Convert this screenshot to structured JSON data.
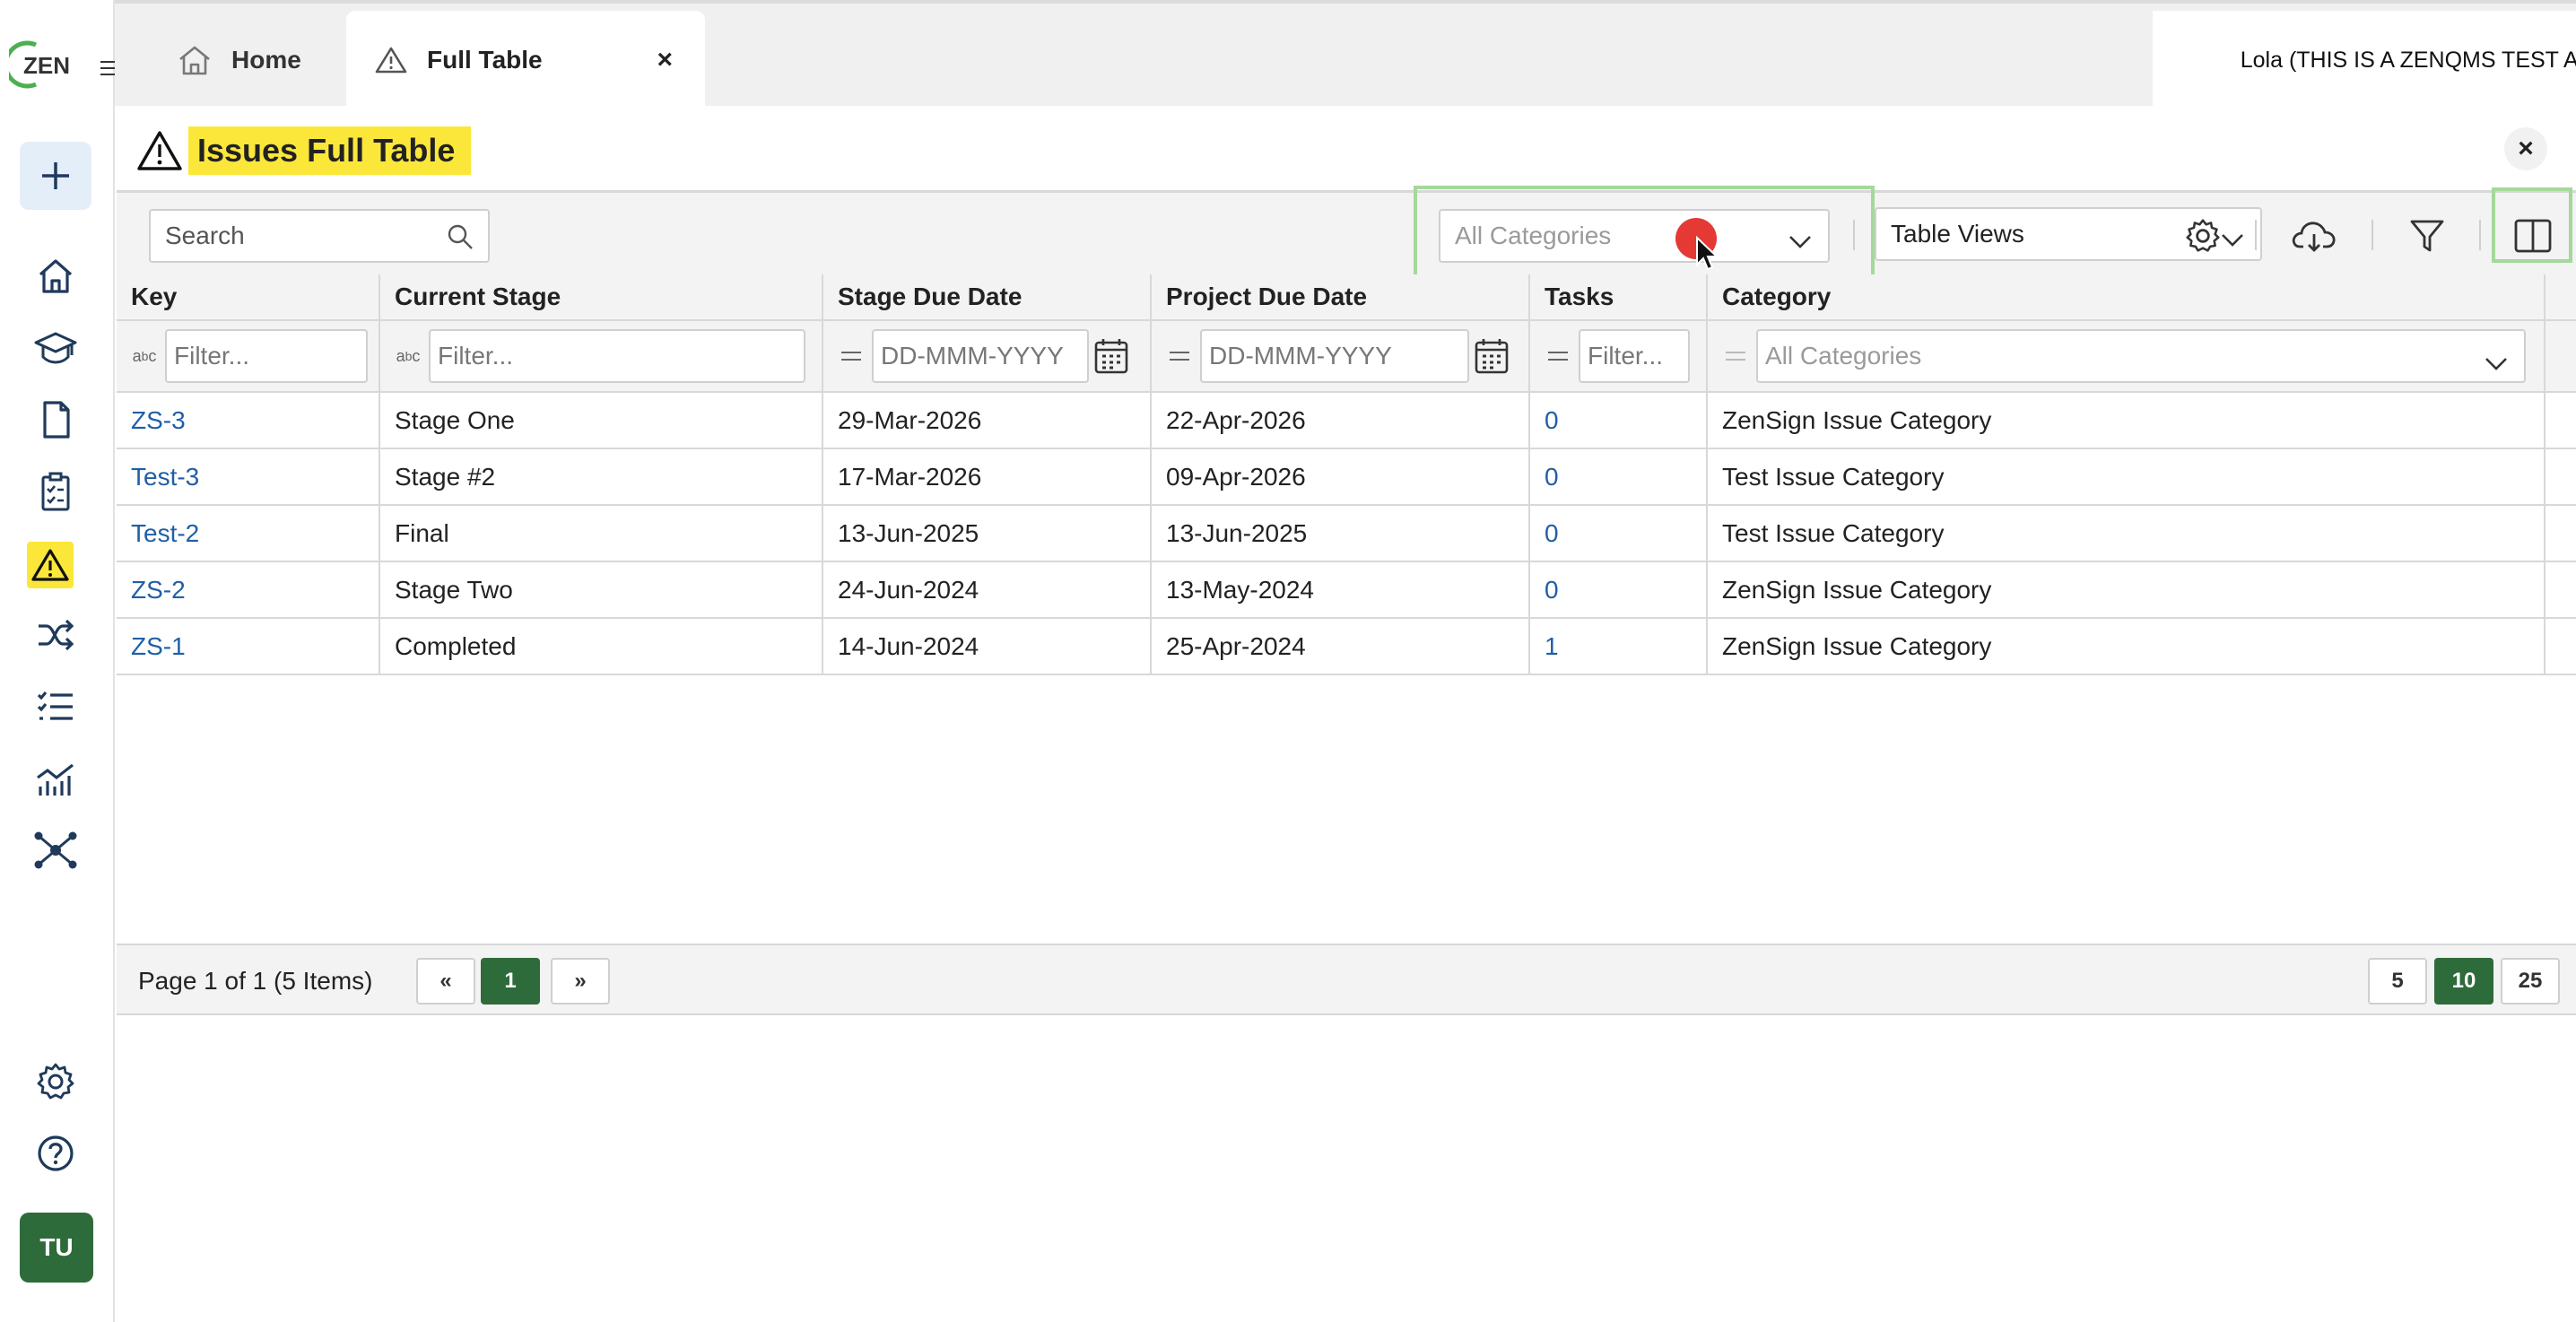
{
  "app": {
    "logo_text": "ZEN"
  },
  "rail": {
    "items": [
      "add",
      "home",
      "training",
      "documents",
      "checklists",
      "issues",
      "shuffle",
      "tasks",
      "analytics",
      "network"
    ],
    "bottom": [
      "settings",
      "help"
    ],
    "avatar_initials": "TU"
  },
  "tabs": [
    {
      "label": "Home",
      "icon": "home-icon"
    },
    {
      "label": "Full Table",
      "icon": "warning-icon",
      "close": "×"
    }
  ],
  "account": "Lola (THIS IS A ZENQMS TEST ACCOUNT)",
  "panel": {
    "title": "Issues Full Table",
    "close": "×"
  },
  "toolbar": {
    "search_placeholder": "Search",
    "category_placeholder": "All Categories",
    "views_label": "Table Views"
  },
  "table": {
    "columns": [
      "Key",
      "Current Stage",
      "Stage Due Date",
      "Project Due Date",
      "Tasks",
      "Category"
    ],
    "filters": {
      "key": "Filter...",
      "stage": "Filter...",
      "stage_due": "DD-MMM-YYYY",
      "project_due": "DD-MMM-YYYY",
      "tasks": "Filter...",
      "category": "All Categories"
    },
    "rows": [
      {
        "key": "ZS-3",
        "stage": "Stage One",
        "stage_due": "29-Mar-2026",
        "project_due": "22-Apr-2026",
        "tasks": "0",
        "category": "ZenSign Issue Category"
      },
      {
        "key": "Test-3",
        "stage": "Stage #2",
        "stage_due": "17-Mar-2026",
        "project_due": "09-Apr-2026",
        "tasks": "0",
        "category": "Test Issue Category"
      },
      {
        "key": "Test-2",
        "stage": "Final",
        "stage_due": "13-Jun-2025",
        "project_due": "13-Jun-2025",
        "tasks": "0",
        "category": "Test Issue Category"
      },
      {
        "key": "ZS-2",
        "stage": "Stage Two",
        "stage_due": "24-Jun-2024",
        "project_due": "13-May-2024",
        "tasks": "0",
        "category": "ZenSign Issue Category"
      },
      {
        "key": "ZS-1",
        "stage": "Completed",
        "stage_due": "14-Jun-2024",
        "project_due": "25-Apr-2024",
        "tasks": "1",
        "category": "ZenSign Issue Category"
      }
    ]
  },
  "pager": {
    "info": "Page 1 of 1 (5 Items)",
    "prev": "«",
    "current": "1",
    "next": "»",
    "sizes": [
      "5",
      "10",
      "25"
    ],
    "active_size": "10"
  },
  "colors": {
    "accent_green": "#2e6b3a",
    "highlight_yellow": "#fbe739",
    "link_blue": "#1f5fa6",
    "annotation_green": "#a5d89a",
    "cursor_dot_red": "#e53935"
  }
}
